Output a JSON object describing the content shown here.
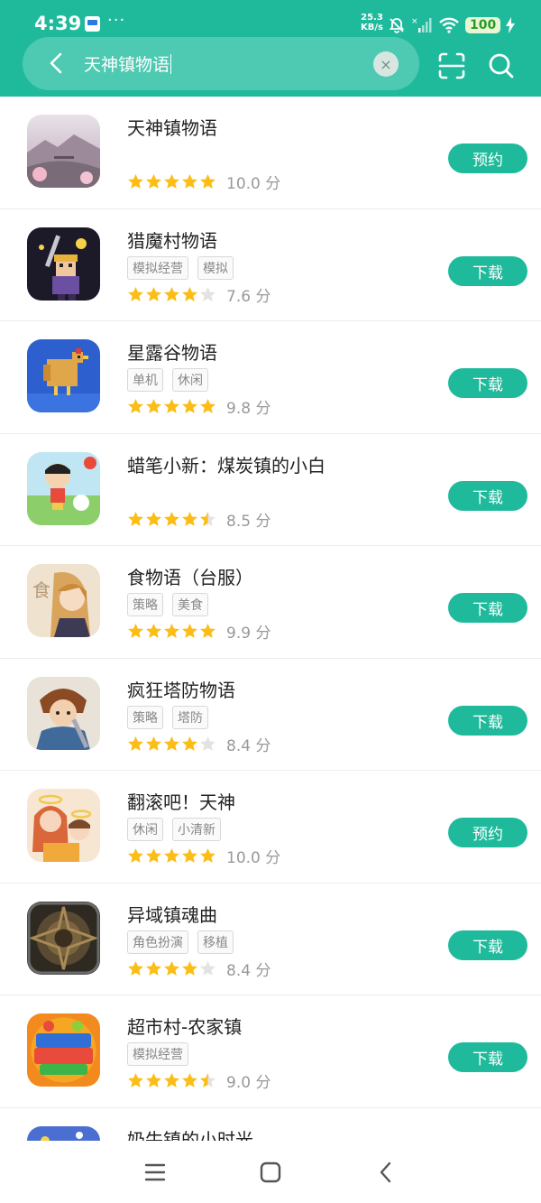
{
  "status_bar": {
    "time": "4:39",
    "dots": "···",
    "net_speed_value": "25.3",
    "net_speed_unit": "KB/s",
    "battery": "100"
  },
  "search": {
    "query": "天神镇物语",
    "clear_symbol": "×"
  },
  "colors": {
    "brand": "#1fba9c",
    "star": "#fbbd16",
    "star_empty": "#e3e3e3"
  },
  "results": [
    {
      "title": "天神镇物语",
      "tags": [],
      "stars": 5,
      "rating": "10.0 分",
      "action": "预约",
      "icon": "game-icon-tianshen"
    },
    {
      "title": "猎魔村物语",
      "tags": [
        "模拟经营",
        "模拟"
      ],
      "stars": 4,
      "rating": "7.6 分",
      "action": "下载",
      "icon": "game-icon-liemo"
    },
    {
      "title": "星露谷物语",
      "tags": [
        "单机",
        "休闲"
      ],
      "stars": 5,
      "rating": "9.8 分",
      "action": "下载",
      "icon": "game-icon-stardew"
    },
    {
      "title": "蜡笔小新：煤炭镇的小白",
      "tags": [],
      "stars": 4.5,
      "rating": "8.5 分",
      "action": "下载",
      "icon": "game-icon-shinchan"
    },
    {
      "title": "食物语（台服）",
      "tags": [
        "策略",
        "美食"
      ],
      "stars": 5,
      "rating": "9.9 分",
      "action": "下载",
      "icon": "game-icon-shiwuyu"
    },
    {
      "title": "疯狂塔防物语",
      "tags": [
        "策略",
        "塔防"
      ],
      "stars": 4,
      "rating": "8.4 分",
      "action": "下载",
      "icon": "game-icon-tafang"
    },
    {
      "title": "翻滚吧！天神",
      "tags": [
        "休闲",
        "小清新"
      ],
      "stars": 5,
      "rating": "10.0 分",
      "action": "预约",
      "icon": "game-icon-fangun"
    },
    {
      "title": "异域镇魂曲",
      "tags": [
        "角色扮演",
        "移植"
      ],
      "stars": 4,
      "rating": "8.4 分",
      "action": "下载",
      "icon": "game-icon-planescape"
    },
    {
      "title": "超市村-农家镇",
      "tags": [
        "模拟经营"
      ],
      "stars": 4.5,
      "rating": "9.0 分",
      "action": "下载",
      "icon": "game-icon-supermarket"
    },
    {
      "title": "奶牛镇的小时光",
      "tags": [],
      "stars": 0,
      "rating": "",
      "action": "",
      "icon": "game-icon-cowtown"
    }
  ]
}
